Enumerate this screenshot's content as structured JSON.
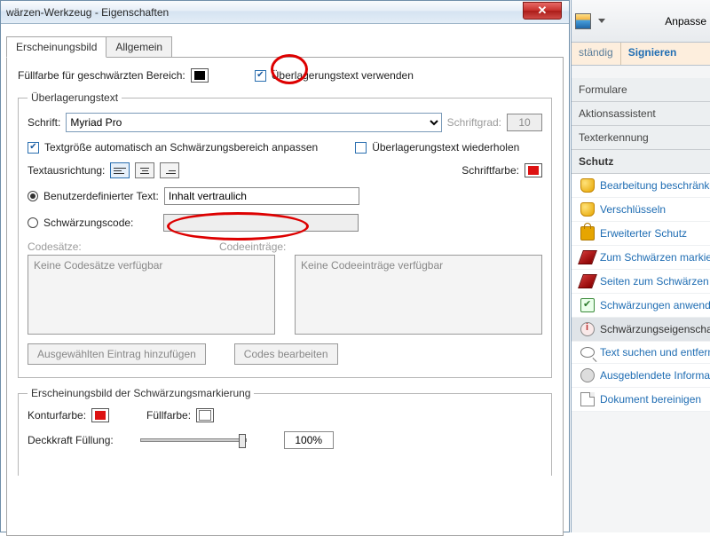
{
  "dialog": {
    "title": "wärzen-Werkzeug - Eigenschaften",
    "tabs": {
      "appearance": "Erscheinungsbild",
      "general": "Allgemein"
    },
    "fill_label": "Füllfarbe für geschwärzten Bereich:",
    "overlay_checkbox": "Überlagerungstext verwenden",
    "overlay_group": "Überlagerungstext",
    "font_label": "Schrift:",
    "font_value": "Myriad Pro",
    "fontsize_label": "Schriftgrad:",
    "fontsize_value": "10",
    "autosize": "Textgröße automatisch an Schwärzungsbereich anpassen",
    "repeat": "Überlagerungstext wiederholen",
    "align_label": "Textausrichtung:",
    "fontcolor_label": "Schriftfarbe:",
    "custom_text_label": "Benutzerdefinierter Text:",
    "custom_text_value": "Inhalt vertraulich",
    "redaction_code_label": "Schwärzungscode:",
    "codesets_label": "Codesätze:",
    "codeentries_label": "Codeeinträge:",
    "codesets_empty": "Keine Codesätze verfügbar",
    "codeentries_empty": "Keine Codeeinträge verfügbar",
    "btn_add": "Ausgewählten Eintrag hinzufügen",
    "btn_editcodes": "Codes bearbeiten",
    "mark_group": "Erscheinungsbild der Schwärzungsmarkierung",
    "outline_label": "Konturfarbe:",
    "fill2_label": "Füllfarbe:",
    "opacity_label": "Deckkraft Füllung:",
    "opacity_value": "100%"
  },
  "right": {
    "customize": "Anpasse",
    "tab_full": "ständig",
    "tab_sign": "Signieren",
    "sections": {
      "forms": "Formulare",
      "actions": "Aktionsassistent",
      "ocr": "Texterkennung",
      "protect": "Schutz"
    },
    "items": {
      "restrict": "Bearbeitung beschränken",
      "encrypt": "Verschlüsseln",
      "extended": "Erweiterter Schutz",
      "mark": "Zum Schwärzen markieren",
      "markpages": "Seiten zum Schwärzen mark",
      "apply": "Schwärzungen anwenden",
      "props": "Schwärzungseigenschaften",
      "searchremove": "Text suchen und entfernen",
      "hidden": "Ausgeblendete Information",
      "sanitize": "Dokument bereinigen"
    }
  }
}
